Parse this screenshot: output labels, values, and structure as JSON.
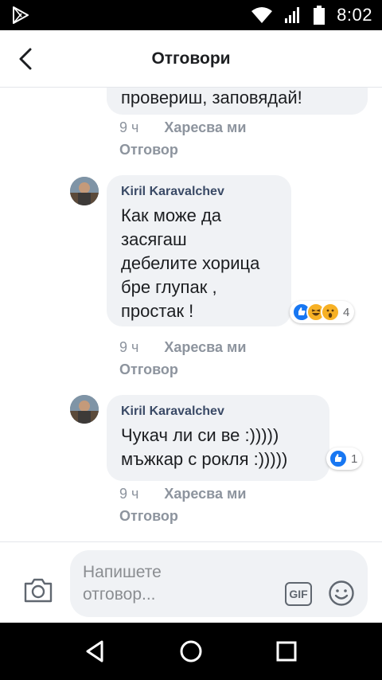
{
  "status": {
    "time": "8:02"
  },
  "header": {
    "title": "Отговори"
  },
  "thread": {
    "partial": {
      "text": "провериш, заповядай!",
      "time": "9 ч",
      "like": "Харесва ми",
      "reply": "Отговор"
    },
    "comments": [
      {
        "author": "Kiril Karavalchev",
        "text": "Как може да\nзасягаш\nдебелите хорица\nбре глупак ,\nпростак !",
        "time": "9 ч",
        "like": "Харесва ми",
        "reply": "Отговор",
        "reactions": {
          "icons": [
            "like-reaction-icon",
            "haha-reaction-icon",
            "wow-reaction-icon"
          ],
          "count": "4"
        }
      },
      {
        "author": "Kiril Karavalchev",
        "text": "Чукач ли си ве :)))))\nмъжкар с рокля :)))))",
        "time": "9 ч",
        "like": "Харесва ми",
        "reply": "Отговор",
        "reactions": {
          "icons": [
            "like-reaction-icon"
          ],
          "count": "1"
        }
      }
    ]
  },
  "composer": {
    "placeholder": "Напишете\nотговор...",
    "gif_label": "GIF"
  },
  "colors": {
    "accent": "#1877f2",
    "bubble": "#f0f2f5",
    "meta": "#8d949e"
  }
}
